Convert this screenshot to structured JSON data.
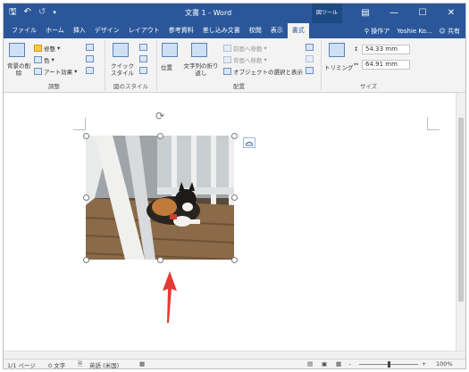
{
  "titlebar": {
    "doc_title": "文書 1 - Word",
    "context_tools": "図ツール",
    "save_icon": "save-icon",
    "undo_icon": "undo-icon",
    "redo_icon": "redo-icon",
    "customize_icon": "chevron-down-icon"
  },
  "tabs": {
    "items": [
      "ファイル",
      "ホーム",
      "挿入",
      "デザイン",
      "レイアウト",
      "参考資料",
      "差し込み文書",
      "校閲",
      "表示",
      "書式"
    ],
    "active_index": 9,
    "tell_me": "操作ア",
    "user": "Yoshie Ko...",
    "share": "共有"
  },
  "ribbon": {
    "remove_bg": "背景の削除",
    "corrections": "修整",
    "color": "色",
    "artistic": "アート効果",
    "group_adjust": "調整",
    "quick_styles": "クイック スタイル",
    "group_styles": "図のスタイル",
    "position": "位置",
    "wrap_text": "文字列の折り返し",
    "bring_forward": "前面へ移動",
    "send_backward": "背面へ移動",
    "selection_pane": "オブジェクトの選択と表示",
    "group_arrange": "配置",
    "crop": "トリミング",
    "height": "54.33 mm",
    "width": "64.91 mm",
    "group_size": "サイズ"
  },
  "statusbar": {
    "page": "1/1 ページ",
    "words": "0 文字",
    "language": "英語 (米国)",
    "zoom": "100%"
  },
  "colors": {
    "accent": "#2b579a",
    "annotation_arrow": "#e53935"
  }
}
